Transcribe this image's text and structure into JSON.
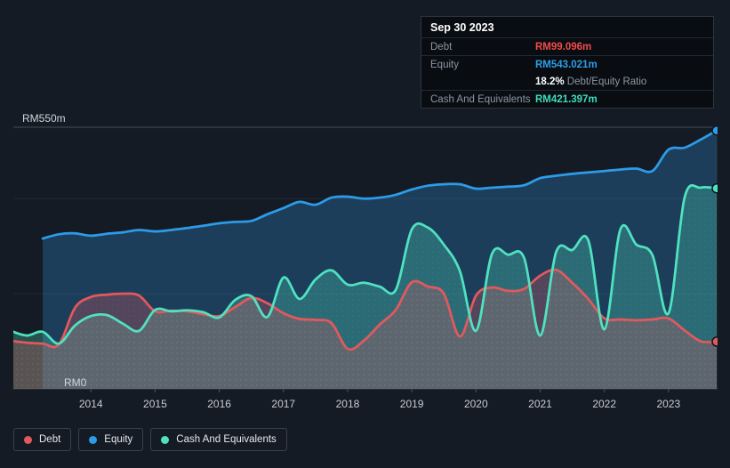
{
  "y_axis": {
    "top_label": "RM550m",
    "bottom_label": "RM0"
  },
  "tooltip": {
    "date": "Sep 30 2023",
    "debt_label": "Debt",
    "debt_value": "RM99.096m",
    "equity_label": "Equity",
    "equity_value": "RM543.021m",
    "ratio_value": "18.2%",
    "ratio_label": " Debt/Equity Ratio",
    "cash_label": "Cash And Equivalents",
    "cash_value": "RM421.397m"
  },
  "legend": {
    "items": [
      {
        "label": "Debt",
        "color": "#e2595d"
      },
      {
        "label": "Equity",
        "color": "#2d9be8"
      },
      {
        "label": "Cash And Equivalents",
        "color": "#50e2c0"
      }
    ]
  },
  "chart_data": {
    "type": "area",
    "title": "",
    "x": [
      "2012-09",
      "2012-12",
      "2013-03",
      "2013-06",
      "2013-09",
      "2013-12",
      "2014-03",
      "2014-06",
      "2014-09",
      "2014-12",
      "2015-03",
      "2015-06",
      "2015-09",
      "2015-12",
      "2016-03",
      "2016-06",
      "2016-09",
      "2016-12",
      "2017-03",
      "2017-06",
      "2017-09",
      "2017-12",
      "2018-03",
      "2018-06",
      "2018-09",
      "2018-12",
      "2019-03",
      "2019-06",
      "2019-09",
      "2019-12",
      "2020-03",
      "2020-06",
      "2020-09",
      "2020-12",
      "2021-03",
      "2021-06",
      "2021-09",
      "2021-12",
      "2022-03",
      "2022-06",
      "2022-09",
      "2022-12",
      "2023-03",
      "2023-06",
      "2023-09"
    ],
    "x_ticks": [
      "2014",
      "2015",
      "2016",
      "2017",
      "2018",
      "2019",
      "2020",
      "2021",
      "2022",
      "2023"
    ],
    "ylim": [
      0,
      550
    ],
    "gridlines": [
      550,
      400,
      200,
      0
    ],
    "y_unit": "RM millions",
    "series": [
      {
        "name": "Equity",
        "color": "#2d9be8",
        "values": [
          null,
          null,
          316,
          325,
          327,
          322,
          326,
          329,
          334,
          331,
          334,
          338,
          343,
          348,
          351,
          353,
          367,
          380,
          393,
          387,
          402,
          404,
          400,
          402,
          408,
          419,
          427,
          430,
          430,
          421,
          423,
          425,
          428,
          443,
          448,
          452,
          455,
          458,
          461,
          463,
          458,
          503,
          507,
          524,
          543.021
        ]
      },
      {
        "name": "Cash And Equivalents",
        "color": "#50e2c0",
        "values": [
          122,
          112,
          120,
          95,
          133,
          153,
          155,
          137,
          122,
          166,
          163,
          165,
          161,
          150,
          187,
          195,
          151,
          234,
          189,
          230,
          249,
          219,
          223,
          215,
          208,
          335,
          339,
          303,
          247,
          122,
          284,
          282,
          275,
          112,
          288,
          292,
          312,
          125,
          335,
          303,
          281,
          159,
          402,
          423,
          421.397
        ]
      },
      {
        "name": "Debt",
        "color": "#e2595d",
        "values": [
          101,
          97,
          95,
          93,
          170,
          193,
          198,
          200,
          196,
          163,
          164,
          163,
          157,
          153,
          172,
          191,
          180,
          159,
          147,
          145,
          138,
          84,
          101,
          135,
          166,
          224,
          215,
          200,
          110,
          196,
          213,
          206,
          210,
          238,
          250,
          223,
          189,
          148,
          146,
          144,
          146,
          148,
          123,
          100,
          99.096
        ]
      }
    ],
    "legend_position": "bottom-left"
  }
}
